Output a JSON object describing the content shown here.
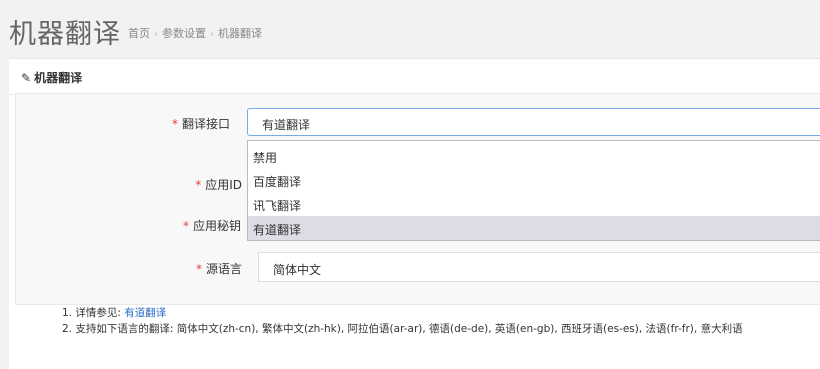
{
  "page": {
    "title": "机器翻译",
    "breadcrumb": [
      "首页",
      "参数设置",
      "机器翻译"
    ],
    "breadcrumb_sep": "›"
  },
  "panel": {
    "pencil_icon": "✎",
    "title": "机器翻译"
  },
  "form": {
    "translate_api": {
      "required_mark": "*",
      "label": "翻译接口",
      "value": "有道翻译",
      "options": [
        "禁用",
        "百度翻译",
        "讯飞翻译",
        "有道翻译"
      ],
      "selected_index": 3
    },
    "app_id": {
      "required_mark": "*",
      "label": "应用ID"
    },
    "app_secret": {
      "required_mark": "*",
      "label": "应用秘钥"
    },
    "source_lang": {
      "required_mark": "*",
      "label": "源语言",
      "value": "简体中文"
    }
  },
  "notes": {
    "line1_prefix": "1. 详情参见: ",
    "line1_link": "有道翻译",
    "line2": "2. 支持如下语言的翻译: 简体中文(zh-cn), 繁体中文(zh-hk), 阿拉伯语(ar-ar), 德语(de-de), 英语(en-gb), 西班牙语(es-es), 法语(fr-fr), 意大利语"
  },
  "colors": {
    "accent_link": "#2a6ac8",
    "required": "#e04040",
    "focus_border": "#7aa7e8",
    "selected_option": "#dcdce4"
  }
}
